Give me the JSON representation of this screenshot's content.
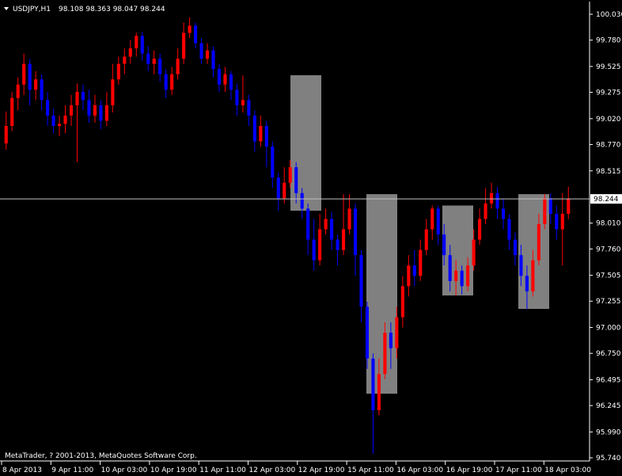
{
  "header": {
    "symbol": "USDJPY,H1",
    "ohlc": "98.108 98.363 98.047 98.244"
  },
  "footer": {
    "copyright": "MetaTrader, ? 2001-2013, MetaQuotes Software Corp."
  },
  "colors": {
    "background": "#000000",
    "axis": "#ffffff",
    "bull": "#ff0000",
    "bear": "#0000ff",
    "box": "#808080",
    "price_line": "#c0c0c0"
  },
  "chart_data": {
    "type": "candlestick",
    "symbol": "USDJPY",
    "timeframe": "H1",
    "ylim": [
      95.74,
      100.03
    ],
    "y_ticks": [
      "100.030",
      "99.780",
      "99.525",
      "99.275",
      "99.020",
      "98.770",
      "98.515",
      "98.010",
      "97.760",
      "97.505",
      "97.255",
      "97.000",
      "96.750",
      "96.495",
      "96.245",
      "95.990",
      "95.740"
    ],
    "current_price": "98.244",
    "x_ticks": [
      "8 Apr 2013",
      "9 Apr 11:00",
      "10 Apr 03:00",
      "10 Apr 19:00",
      "11 Apr 11:00",
      "12 Apr 03:00",
      "12 Apr 19:00",
      "15 Apr 11:00",
      "16 Apr 03:00",
      "16 Apr 19:00",
      "17 Apr 11:00",
      "18 Apr 03:00"
    ],
    "grid": false,
    "highlight_boxes": [
      {
        "from": "12 Apr 04:00",
        "to": "12 Apr 20:00",
        "high": 99.44,
        "low": 98.13
      },
      {
        "from": "15 Apr 08:00",
        "to": "16 Apr 00:00",
        "high": 98.29,
        "low": 96.36
      },
      {
        "from": "16 Apr 12:00",
        "to": "16 Apr 22:00",
        "high": 98.18,
        "low": 97.31
      },
      {
        "from": "17 Apr 12:00",
        "to": "17 Apr 22:00",
        "high": 98.29,
        "low": 97.18
      }
    ],
    "candles": [
      [
        98.78,
        98.95,
        99.09,
        98.72
      ],
      [
        98.95,
        99.22,
        99.28,
        98.9
      ],
      [
        99.22,
        99.35,
        99.42,
        99.1
      ],
      [
        99.35,
        99.55,
        99.65,
        99.25
      ],
      [
        99.55,
        99.3,
        99.6,
        99.15
      ],
      [
        99.3,
        99.4,
        99.48,
        99.2
      ],
      [
        99.4,
        99.2,
        99.45,
        99.1
      ],
      [
        99.2,
        99.05,
        99.28,
        98.95
      ],
      [
        99.05,
        98.95,
        99.12,
        98.88
      ],
      [
        98.95,
        98.97,
        99.05,
        98.85
      ],
      [
        98.97,
        99.05,
        99.15,
        98.88
      ],
      [
        99.05,
        99.15,
        99.25,
        98.95
      ],
      [
        99.15,
        99.28,
        99.36,
        98.6
      ],
      [
        99.28,
        99.2,
        99.35,
        99.1
      ],
      [
        99.2,
        99.05,
        99.3,
        98.98
      ],
      [
        99.05,
        99.15,
        99.25,
        98.98
      ],
      [
        99.15,
        99.0,
        99.2,
        98.92
      ],
      [
        99.0,
        99.15,
        99.28,
        98.95
      ],
      [
        99.15,
        99.4,
        99.55,
        99.08
      ],
      [
        99.4,
        99.55,
        99.62,
        99.35
      ],
      [
        99.55,
        99.62,
        99.7,
        99.45
      ],
      [
        99.62,
        99.7,
        99.78,
        99.55
      ],
      [
        99.7,
        99.82,
        99.85,
        99.62
      ],
      [
        99.82,
        99.65,
        99.86,
        99.58
      ],
      [
        99.65,
        99.55,
        99.72,
        99.48
      ],
      [
        99.55,
        99.6,
        99.68,
        99.45
      ],
      [
        99.6,
        99.45,
        99.65,
        99.38
      ],
      [
        99.45,
        99.3,
        99.5,
        99.22
      ],
      [
        99.3,
        99.45,
        99.52,
        99.25
      ],
      [
        99.45,
        99.6,
        99.7,
        99.4
      ],
      [
        99.6,
        99.85,
        99.95,
        99.55
      ],
      [
        99.85,
        99.92,
        100.0,
        99.8
      ],
      [
        99.92,
        99.75,
        99.95,
        99.7
      ],
      [
        99.75,
        99.6,
        99.8,
        99.55
      ],
      [
        99.6,
        99.68,
        99.75,
        99.55
      ],
      [
        99.68,
        99.5,
        99.72,
        99.42
      ],
      [
        99.5,
        99.35,
        99.55,
        99.28
      ],
      [
        99.35,
        99.45,
        99.52,
        99.28
      ],
      [
        99.45,
        99.3,
        99.48,
        99.2
      ],
      [
        99.3,
        99.15,
        99.36,
        99.05
      ],
      [
        99.15,
        99.2,
        99.44,
        99.08
      ],
      [
        99.2,
        99.05,
        99.25,
        98.95
      ],
      [
        99.05,
        98.8,
        99.1,
        98.7
      ],
      [
        98.8,
        98.95,
        99.05,
        98.75
      ],
      [
        98.95,
        98.75,
        99.0,
        98.55
      ],
      [
        98.75,
        98.45,
        98.8,
        98.35
      ],
      [
        98.45,
        98.25,
        98.5,
        98.13
      ],
      [
        98.25,
        98.4,
        98.55,
        98.2
      ],
      [
        98.4,
        98.55,
        98.62,
        98.35
      ],
      [
        98.55,
        98.3,
        98.6,
        98.2
      ],
      [
        98.3,
        98.15,
        98.35,
        98.05
      ],
      [
        98.15,
        97.85,
        98.2,
        97.7
      ],
      [
        97.85,
        97.65,
        98.05,
        97.55
      ],
      [
        97.65,
        97.95,
        98.1,
        97.6
      ],
      [
        97.95,
        98.05,
        98.15,
        97.9
      ],
      [
        98.05,
        97.85,
        98.12,
        97.75
      ],
      [
        97.85,
        97.75,
        97.9,
        97.6
      ],
      [
        97.75,
        97.95,
        98.29,
        97.7
      ],
      [
        97.95,
        98.15,
        98.29,
        97.9
      ],
      [
        98.15,
        97.7,
        98.2,
        97.5
      ],
      [
        97.7,
        97.2,
        97.75,
        97.05
      ],
      [
        97.2,
        96.7,
        97.25,
        96.6
      ],
      [
        96.7,
        96.2,
        96.75,
        95.78
      ],
      [
        96.2,
        96.55,
        96.7,
        96.15
      ],
      [
        96.55,
        96.95,
        97.05,
        96.5
      ],
      [
        96.95,
        96.8,
        97.05,
        96.6
      ],
      [
        96.8,
        97.1,
        97.2,
        96.7
      ],
      [
        97.1,
        97.4,
        97.5,
        97.0
      ],
      [
        97.4,
        97.6,
        97.7,
        97.3
      ],
      [
        97.6,
        97.5,
        97.75,
        97.4
      ],
      [
        97.5,
        97.75,
        97.85,
        97.45
      ],
      [
        97.75,
        97.95,
        98.05,
        97.7
      ],
      [
        97.95,
        98.15,
        98.18,
        97.85
      ],
      [
        98.15,
        97.9,
        98.18,
        97.8
      ],
      [
        97.9,
        97.7,
        98.0,
        97.6
      ],
      [
        97.7,
        97.45,
        97.8,
        97.35
      ],
      [
        97.45,
        97.55,
        97.65,
        97.31
      ],
      [
        97.55,
        97.4,
        97.6,
        97.32
      ],
      [
        97.4,
        97.6,
        97.68,
        97.35
      ],
      [
        97.6,
        97.85,
        97.95,
        97.55
      ],
      [
        97.85,
        98.05,
        98.15,
        97.8
      ],
      [
        98.05,
        98.2,
        98.35,
        98.0
      ],
      [
        98.2,
        98.3,
        98.4,
        98.15
      ],
      [
        98.3,
        98.15,
        98.36,
        98.05
      ],
      [
        98.15,
        98.05,
        98.25,
        97.95
      ],
      [
        98.05,
        97.85,
        98.1,
        97.75
      ],
      [
        97.85,
        97.7,
        97.92,
        97.6
      ],
      [
        97.7,
        97.5,
        97.8,
        97.4
      ],
      [
        97.5,
        97.35,
        97.6,
        97.18
      ],
      [
        97.35,
        97.65,
        97.75,
        97.3
      ],
      [
        97.65,
        98.0,
        98.1,
        97.6
      ],
      [
        98.0,
        98.25,
        98.29,
        97.95
      ],
      [
        98.25,
        98.1,
        98.3,
        98.0
      ],
      [
        98.1,
        97.95,
        98.18,
        97.85
      ],
      [
        97.95,
        98.1,
        98.3,
        97.6
      ],
      [
        98.1,
        98.244,
        98.363,
        98.047
      ]
    ]
  }
}
